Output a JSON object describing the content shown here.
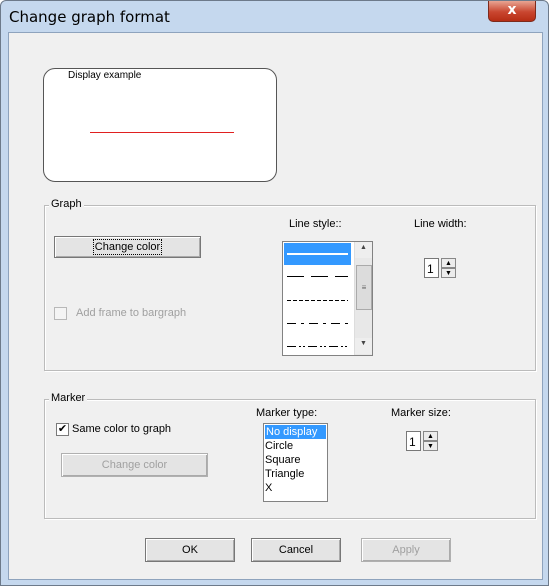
{
  "window": {
    "title": "Change graph format",
    "close_glyph": "x"
  },
  "preview": {
    "label": "Display example",
    "line_color": "#e02020"
  },
  "graph": {
    "group_label": "Graph",
    "change_color_label": "Change color",
    "add_frame_label": "Add frame to bargraph",
    "add_frame_checked": false,
    "line_style_label": "Line style::",
    "line_style_options": [
      "solid",
      "long-dash",
      "short-dash",
      "dash-dot",
      "dash-dot-dot"
    ],
    "line_style_selected": "solid",
    "line_width_label": "Line width:",
    "line_width_value": "1"
  },
  "marker": {
    "group_label": "Marker",
    "same_color_label": "Same color to graph",
    "same_color_checked": true,
    "check_glyph": "✔",
    "change_color_label": "Change color",
    "marker_type_label": "Marker type:",
    "marker_types": [
      "No display",
      "Circle",
      "Square",
      "Triangle",
      "X"
    ],
    "marker_type_selected": "No display",
    "marker_size_label": "Marker size:",
    "marker_size_value": "1"
  },
  "buttons": {
    "ok": "OK",
    "cancel": "Cancel",
    "apply": "Apply"
  },
  "icons": {
    "up_arrow": "▲",
    "down_arrow": "▼",
    "grip": "≡"
  }
}
